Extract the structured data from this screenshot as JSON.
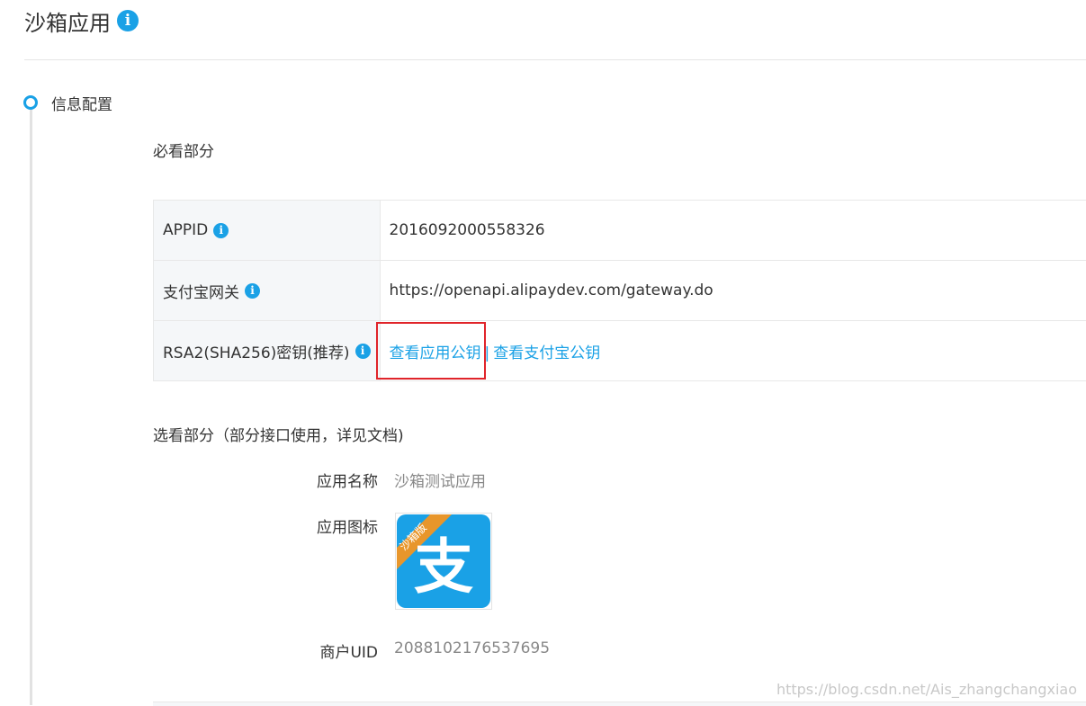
{
  "header": {
    "title": "沙箱应用",
    "info_icon": "i"
  },
  "step": {
    "title": "信息配置"
  },
  "required_section": {
    "title": "必看部分",
    "rows": [
      {
        "label": "APPID",
        "info_icon": "i",
        "value": "2016092000558326"
      },
      {
        "label": "支付宝网关",
        "info_icon": "i",
        "value": "https://openapi.alipaydev.com/gateway.do"
      },
      {
        "label": "RSA2(SHA256)密钥(推荐)",
        "info_icon": "i",
        "link_app_key": "查看应用公钥",
        "separator": "|",
        "link_alipay_key": "查看支付宝公钥"
      }
    ]
  },
  "optional_section": {
    "title": "选看部分（部分接口使用，详见文档)",
    "app_name_label": "应用名称",
    "app_name_value": "沙箱测试应用",
    "app_icon_label": "应用图标",
    "app_icon_badge": "沙箱版",
    "app_icon_char": "支",
    "uid_label": "商户UID",
    "uid_value": "2088102176537695"
  },
  "watermark": "https://blog.csdn.net/Ais_zhangchangxiao",
  "colors": {
    "accent": "#1aa1e6",
    "highlight_border": "#e0242a",
    "badge": "#e8962b"
  }
}
